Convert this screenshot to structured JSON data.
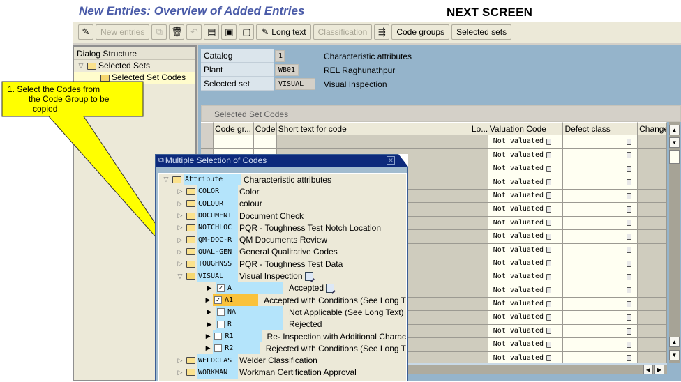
{
  "page": {
    "title": "New Entries: Overview of Added Entries",
    "annotation": "NEXT SCREEN"
  },
  "toolbar": {
    "items": [
      {
        "type": "icon",
        "icon": "glasses-change-icon",
        "glyph": "✎",
        "enabled": true
      },
      {
        "type": "button",
        "label": "New entries",
        "enabled": false
      },
      {
        "type": "icon",
        "icon": "copy-icon",
        "glyph": "⧉",
        "enabled": false
      },
      {
        "type": "icon",
        "icon": "delete-icon",
        "glyph": "🗑",
        "enabled": true
      },
      {
        "type": "icon",
        "icon": "undo-icon",
        "glyph": "↶",
        "enabled": false
      },
      {
        "type": "icon",
        "icon": "select-all-icon",
        "glyph": "▤",
        "enabled": true
      },
      {
        "type": "icon",
        "icon": "select-block-icon",
        "glyph": "▣",
        "enabled": true
      },
      {
        "type": "icon",
        "icon": "deselect-all-icon",
        "glyph": "▢",
        "enabled": true
      },
      {
        "type": "button",
        "label": "Long text",
        "icon": "edit-icon",
        "glyph": "✎",
        "enabled": true
      },
      {
        "type": "button",
        "label": "Classification",
        "enabled": false
      },
      {
        "type": "icon",
        "icon": "hierarchy-icon",
        "glyph": "⇶",
        "enabled": true
      },
      {
        "type": "button",
        "label": "Code groups",
        "enabled": true
      },
      {
        "type": "button",
        "label": "Selected sets",
        "enabled": true
      }
    ]
  },
  "dialog_structure": {
    "header": "Dialog Structure",
    "items": [
      {
        "label": "Selected Sets",
        "level": 0,
        "expanded": true
      },
      {
        "label": "Selected Set Codes",
        "level": 1,
        "active": true
      }
    ]
  },
  "header_fields": [
    {
      "label": "Catalog",
      "value": "1",
      "description": "Characteristic attributes"
    },
    {
      "label": "Plant",
      "value": "WB01",
      "description": "REL Raghunathpur"
    },
    {
      "label": "Selected set",
      "value": "VISUAL",
      "description": "Visual Inspection"
    }
  ],
  "table": {
    "title": "Selected Set Codes",
    "columns": [
      "Code gr...",
      "Code",
      "Short text for code",
      "Lo...",
      "Valuation Code",
      "Defect class",
      "Change"
    ],
    "rows": [
      {
        "valuation": "Not valuated"
      },
      {
        "valuation": "Not valuated"
      },
      {
        "valuation": "Not valuated"
      },
      {
        "valuation": "Not valuated"
      },
      {
        "valuation": "Not valuated"
      },
      {
        "valuation": "Not valuated"
      },
      {
        "valuation": "Not valuated"
      },
      {
        "valuation": "Not valuated"
      },
      {
        "valuation": "Not valuated"
      },
      {
        "valuation": "Not valuated"
      },
      {
        "valuation": "Not valuated"
      },
      {
        "valuation": "Not valuated"
      },
      {
        "valuation": "Not valuated"
      },
      {
        "valuation": "Not valuated"
      },
      {
        "valuation": "Not valuated"
      },
      {
        "valuation": "Not valuated"
      },
      {
        "valuation": "Not valuated"
      }
    ]
  },
  "popup": {
    "title": "Multiple Selection of Codes",
    "root": {
      "code": "Attribute",
      "description": "Characteristic attributes"
    },
    "groups": [
      {
        "code": "COLOR",
        "description": "Color",
        "expanded": false
      },
      {
        "code": "COLOUR",
        "description": "colour",
        "expanded": false
      },
      {
        "code": "DOCUMENT",
        "description": "Document Check",
        "expanded": false
      },
      {
        "code": "NOTCHLOC",
        "description": "PQR - Toughness Test Notch Location",
        "expanded": false
      },
      {
        "code": "QM-DOC-R",
        "description": "QM Documents Review",
        "expanded": false
      },
      {
        "code": "QUAL-GEN",
        "description": "General Qualitative Codes",
        "expanded": false
      },
      {
        "code": "TOUGHNSS",
        "description": "PQR - Toughness Test Data",
        "expanded": false
      },
      {
        "code": "VISUAL",
        "description": "Visual Inspection",
        "expanded": true,
        "codes": [
          {
            "code": "A",
            "description": "Accepted",
            "checked": true,
            "has_long_text": true
          },
          {
            "code": "A1",
            "description": "Accepted with Conditions (See Long T",
            "checked": true,
            "selected": true
          },
          {
            "code": "NA",
            "description": "Not Applicable (See Long Text)",
            "checked": false
          },
          {
            "code": "R",
            "description": "Rejected",
            "checked": false
          },
          {
            "code": "R1",
            "description": "Re- Inspection with Additional Charac",
            "checked": false
          },
          {
            "code": "R2",
            "description": "Rejected with Conditions (See Long T",
            "checked": false
          }
        ]
      },
      {
        "code": "WELDCLAS",
        "description": "Welder Classification",
        "expanded": false
      },
      {
        "code": "WORKMAN",
        "description": "Workman Certification Approval",
        "expanded": false
      }
    ]
  },
  "callout": {
    "lines": [
      "1. Select  the Codes from",
      "the Code Group to be",
      "copied"
    ],
    "color": "#ffff00"
  }
}
